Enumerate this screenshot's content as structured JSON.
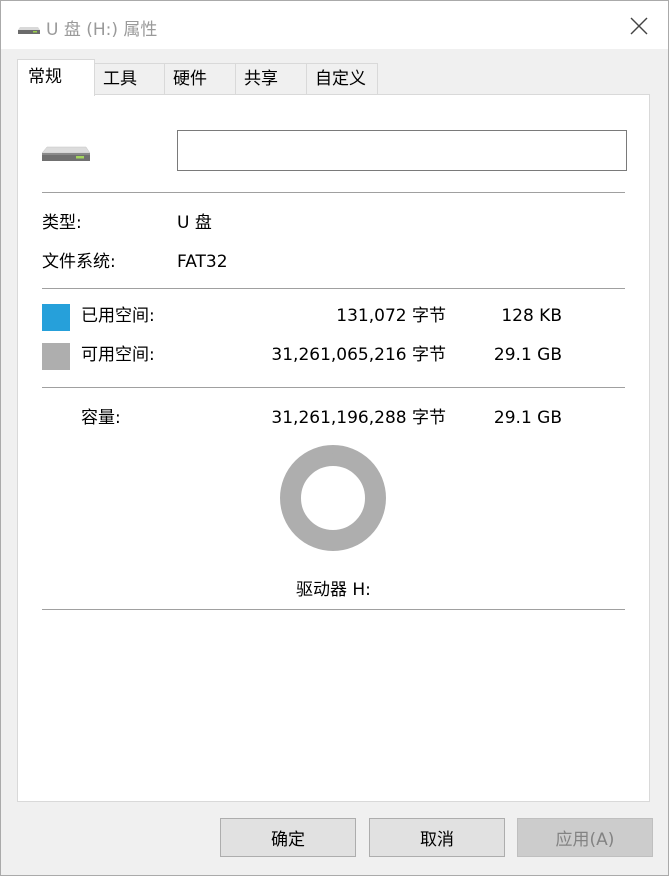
{
  "window": {
    "title": "U 盘 (H:) 属性",
    "close_icon": "close-icon"
  },
  "tabs": [
    {
      "label": "常规",
      "active": true
    },
    {
      "label": "工具",
      "active": false
    },
    {
      "label": "硬件",
      "active": false
    },
    {
      "label": "共享",
      "active": false
    },
    {
      "label": "自定义",
      "active": false
    }
  ],
  "general": {
    "drive_icon": "usb-drive-icon",
    "name_value": "",
    "type_label": "类型:",
    "type_value": "U 盘",
    "fs_label": "文件系统:",
    "fs_value": "FAT32"
  },
  "space": {
    "used": {
      "label": "已用空间:",
      "bytes": "131,072 字节",
      "size": "128 KB",
      "color": "#26a0da"
    },
    "free": {
      "label": "可用空间:",
      "bytes": "31,261,065,216 字节",
      "size": "29.1 GB",
      "color": "#aeaeae"
    },
    "capacity": {
      "label": "容量:",
      "bytes": "31,261,196,288 字节",
      "size": "29.1 GB"
    },
    "used_fraction": 4.2e-06,
    "drive_label": "驱动器 H:"
  },
  "buttons": {
    "ok": "确定",
    "cancel": "取消",
    "apply": "应用(A)"
  }
}
